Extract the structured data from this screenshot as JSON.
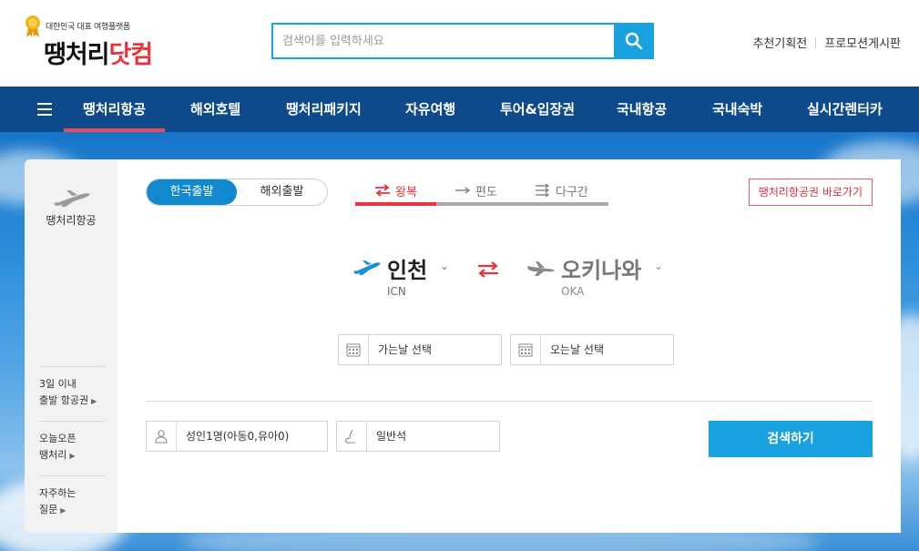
{
  "brand": {
    "tagline": "대한민국 대표 여행플랫폼",
    "name_main": "땡처리",
    "name_suffix": "닷컴"
  },
  "search": {
    "placeholder": "검색어를 입력하세요",
    "icon": "search-icon"
  },
  "util_links": [
    "추천기획전",
    "프로모션게시판"
  ],
  "nav": {
    "items": [
      "땡처리항공",
      "해외호텔",
      "땡처리패키지",
      "자유여행",
      "투어&입장권",
      "국내항공",
      "국내숙박",
      "실시간렌터카"
    ],
    "active_index": 0
  },
  "sidebar": {
    "title": "땡처리항공",
    "links": [
      {
        "line1": "3일 이내",
        "line2": "출발 항공권"
      },
      {
        "line1": "오늘오픈",
        "line2": "땡처리"
      },
      {
        "line1": "자주하는",
        "line2": "질문"
      }
    ]
  },
  "departure_tabs": [
    "한국출발",
    "해외출발"
  ],
  "trip_tabs": [
    "왕복",
    "편도",
    "다구간"
  ],
  "quick_link": "땡처리항공권 바로가기",
  "origin": {
    "city": "인천",
    "code": "ICN"
  },
  "destination": {
    "city": "오키나와",
    "code": "OKA"
  },
  "dates": {
    "depart": "가는날 선택",
    "return": "오는날 선택"
  },
  "passengers": "성인1명(아동0,유아0)",
  "cabin": "일반석",
  "search_button": "검색하기",
  "colors": {
    "brand_blue": "#1aa1e0",
    "nav_bg": "#0f4a8a",
    "accent_red": "#e8323c"
  }
}
